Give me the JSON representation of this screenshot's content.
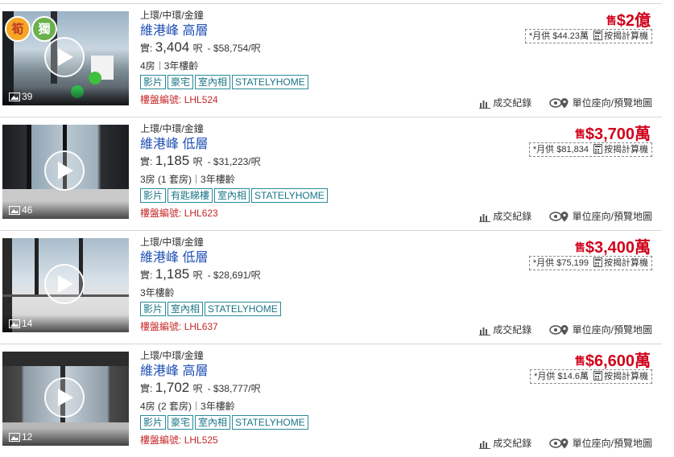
{
  "listings": [
    {
      "district": "上環/中環/金鐘",
      "estate": "維港峰",
      "floor": "高層",
      "area_label": "實:",
      "area": "3,404",
      "area_unit": "呎",
      "per_sqft": "- $58,754/呎",
      "rooms": "4房",
      "age": "3年樓齡",
      "tags": [
        "影片",
        "豪宅",
        "室內相",
        "STATELYHOME"
      ],
      "ref_label": "樓盤編號:",
      "ref": "LHL524",
      "sell_label": "售",
      "price": "$2億",
      "mortgage": "*月供 $44.23萬",
      "calculator": "按揭計算機",
      "transactions": "成交紀錄",
      "map": "單位座向/預覽地圖",
      "photo_count": "39",
      "badges": [
        "筍",
        "獨"
      ]
    },
    {
      "district": "上環/中環/金鐘",
      "estate": "維港峰",
      "floor": "低層",
      "area_label": "實:",
      "area": "1,185",
      "area_unit": "呎",
      "per_sqft": "- $31,223/呎",
      "rooms": "3房 (1 套房)",
      "age": "3年樓齡",
      "tags": [
        "影片",
        "有匙睇樓",
        "室內相",
        "STATELYHOME"
      ],
      "ref_label": "樓盤編號:",
      "ref": "LHL623",
      "sell_label": "售",
      "price": "$3,700萬",
      "mortgage": "*月供 $81,834",
      "calculator": "按揭計算機",
      "transactions": "成交紀錄",
      "map": "單位座向/預覽地圖",
      "photo_count": "46"
    },
    {
      "district": "上環/中環/金鐘",
      "estate": "維港峰",
      "floor": "低層",
      "area_label": "實:",
      "area": "1,185",
      "area_unit": "呎",
      "per_sqft": "- $28,691/呎",
      "rooms": "",
      "age": "3年樓齡",
      "tags": [
        "影片",
        "室內相",
        "STATELYHOME"
      ],
      "ref_label": "樓盤編號:",
      "ref": "LHL637",
      "sell_label": "售",
      "price": "$3,400萬",
      "mortgage": "*月供 $75,199",
      "calculator": "按揭計算機",
      "transactions": "成交紀錄",
      "map": "單位座向/預覽地圖",
      "photo_count": "14"
    },
    {
      "district": "上環/中環/金鐘",
      "estate": "維港峰",
      "floor": "高層",
      "area_label": "實:",
      "area": "1,702",
      "area_unit": "呎",
      "per_sqft": "- $38,777/呎",
      "rooms": "4房 (2 套房)",
      "age": "3年樓齡",
      "tags": [
        "影片",
        "豪宅",
        "室內相",
        "STATELYHOME"
      ],
      "ref_label": "樓盤編號:",
      "ref": "LHL525",
      "sell_label": "售",
      "price": "$6,600萬",
      "mortgage": "*月供 $14.6萬",
      "calculator": "按揭計算機",
      "transactions": "成交紀錄",
      "map": "單位座向/預覽地圖",
      "photo_count": "12"
    }
  ],
  "colors": {
    "title": "#1f4fb5",
    "price": "#d0021b",
    "tag_border": "#2a8a9a",
    "ref": "#c62828"
  }
}
